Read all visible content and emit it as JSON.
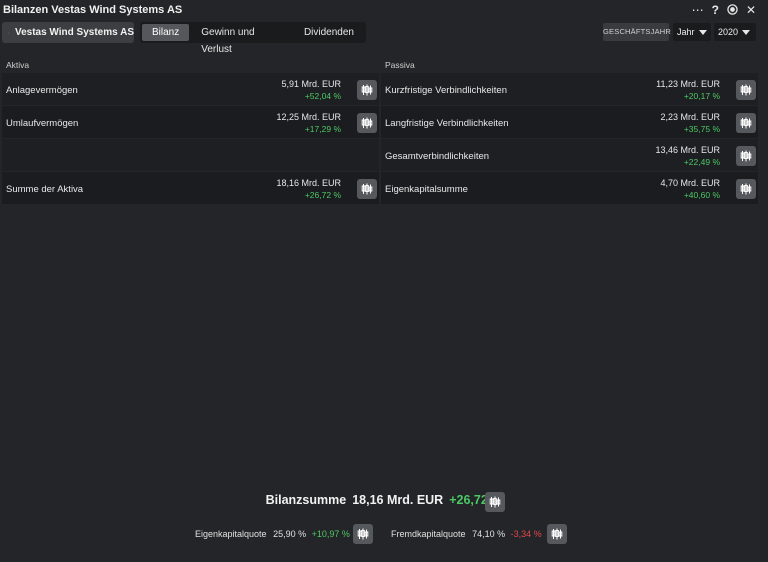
{
  "window": {
    "title": "Bilanzen Vestas Wind Systems AS",
    "controls": [
      "more-icon",
      "help-icon",
      "target-icon",
      "close-icon"
    ]
  },
  "toolbar": {
    "search_value": "Vestas Wind Systems AS",
    "tabs": [
      "Bilanz",
      "Gewinn und Verlust",
      "Dividenden"
    ],
    "active_tab": "Bilanz",
    "period_label": "GESCHÄFTSJAHR",
    "period_type": "Jahr",
    "year": "2020"
  },
  "aktiva": {
    "header": "Aktiva",
    "rows": [
      {
        "label": "Anlagevermögen",
        "value": "5,91 Mrd. EUR",
        "change": "+52,04 %"
      },
      {
        "label": "Umlaufvermögen",
        "value": "12,25 Mrd. EUR",
        "change": "+17,29 %"
      },
      {
        "label": "Summe der Aktiva",
        "value": "18,16 Mrd. EUR",
        "change": "+26,72 %"
      }
    ]
  },
  "passiva": {
    "header": "Passiva",
    "rows": [
      {
        "label": "Kurzfristige Verbindlichkeiten",
        "value": "11,23 Mrd. EUR",
        "change": "+20,17 %"
      },
      {
        "label": "Langfristige Verbindlichkeiten",
        "value": "2,23 Mrd. EUR",
        "change": "+35,75 %"
      },
      {
        "label": "Gesamtverbindlichkeiten",
        "value": "13,46 Mrd. EUR",
        "change": "+22,49 %"
      },
      {
        "label": "Eigenkapitalsumme",
        "value": "4,70 Mrd. EUR",
        "change": "+40,60 %"
      }
    ]
  },
  "summary": {
    "label": "Bilanzsumme",
    "value": "18,16 Mrd. EUR",
    "change": "+26,72 %"
  },
  "ratios": {
    "equity_label": "Eigenkapitalquote",
    "equity_value": "25,90 %",
    "equity_change": "+10,97 %",
    "debt_label": "Fremdkapitalquote",
    "debt_value": "74,10 %",
    "debt_change": "-3,34 %"
  },
  "colors": {
    "positive": "#4cc964",
    "negative": "#e0474c",
    "background": "#242528",
    "panel": "#1e1f22"
  }
}
